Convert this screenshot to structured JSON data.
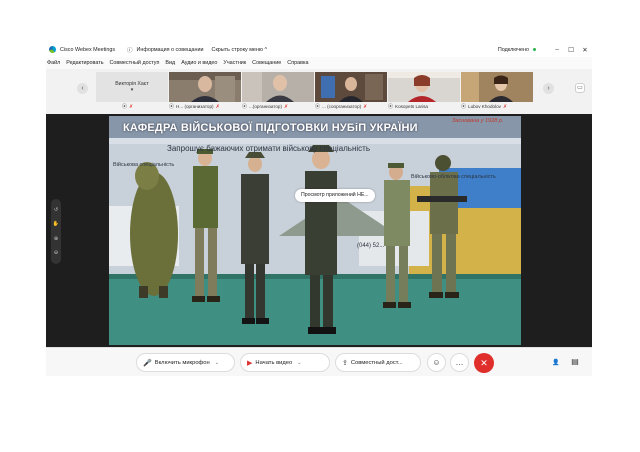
{
  "app": {
    "title": "Cisco Webex Meetings",
    "info_icon": "info-icon",
    "info_label": "Информация о совещании",
    "hide_menu_label": "Скрыть строку меню",
    "hide_menu_chevron": "^",
    "status": "Подключено",
    "status_color": "#2bb24c",
    "window_controls": {
      "minimize": "–",
      "maximize": "☐",
      "close": "✕"
    }
  },
  "menu": [
    "Файл",
    "Редактировать",
    "Совместный доступ",
    "Вид",
    "Аудио и видео",
    "Участник",
    "Совещание",
    "Справка"
  ],
  "participants": {
    "prev_arrow": "‹",
    "next_arrow": "›",
    "host_tile": {
      "name": "Викторія Хаєт"
    },
    "tiles": [
      {
        "name": "Н... (организатор)"
      },
      {
        "name": "...(организатор)"
      },
      {
        "name": "... (соорганизатор)"
      },
      {
        "name": "Kosopets Larisa"
      },
      {
        "name": "Lubov Khodolov"
      }
    ]
  },
  "stage": {
    "share_banner": "Просмотр приложений НЕ...",
    "poster": {
      "headline": "КАФЕДРА ВІЙСЬКОВОЇ ПІДГОТОВКИ НУБіП УКРАЇНИ",
      "founded": "Заснована у 1928 р.",
      "subline": "Запрошує бажаючих отримати військову спеціальність",
      "phone": "(044) 52...",
      "side_text_1": "Військова спеціальність",
      "side_text_2": "Військово-облікова спеціальність"
    },
    "left_tools": [
      "↺",
      "✋",
      "⊕",
      "⊖"
    ]
  },
  "controls": {
    "mic": {
      "label": "Включить микрофон",
      "icon": "mic-muted-icon",
      "chevron": "⌄"
    },
    "video": {
      "label": "Начать видео",
      "icon": "camera-off-icon",
      "chevron": "⌄"
    },
    "share": {
      "label": "Совместный дост...",
      "icon": "share-icon"
    },
    "emoji_glyph": "☺",
    "more_glyph": "…",
    "end_glyph": "✕",
    "participants_glyph": "👤",
    "chat_glyph": "▤",
    "accent": "#e02f2a"
  }
}
